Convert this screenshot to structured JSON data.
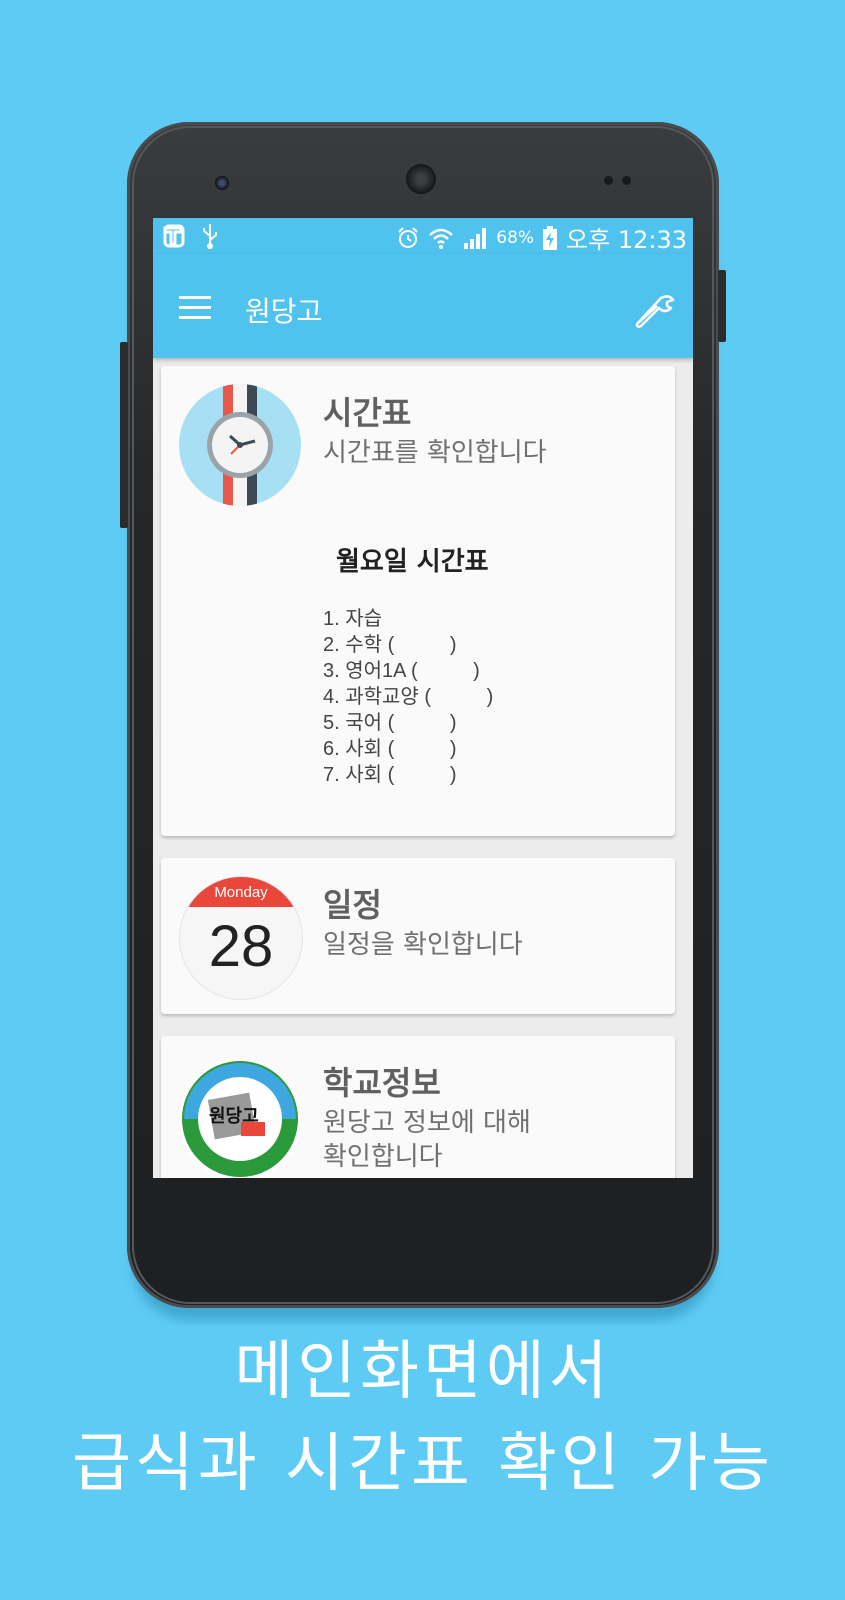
{
  "status_bar": {
    "battery_percent": "68%",
    "time": "오후 12:33",
    "icons": [
      "app-icon",
      "usb-icon",
      "alarm-icon",
      "wifi-icon",
      "signal-icon",
      "battery-icon"
    ]
  },
  "app_bar": {
    "title": "원당고",
    "menu_icon": "menu-icon",
    "settings_icon": "wrench-icon"
  },
  "cards": {
    "timetable": {
      "title": "시간표",
      "subtitle": "시간표를 확인합니다",
      "icon": "watch-icon",
      "heading": "월요일 시간표",
      "periods": [
        "1. 자습",
        "2. 수학 (          )",
        "3. 영어1A (          )",
        "4. 과학교양 (          )",
        "5. 국어 (          )",
        "6. 사회 (          )",
        "7. 사회 (          )"
      ]
    },
    "schedule": {
      "title": "일정",
      "subtitle": "일정을 확인합니다",
      "icon": "calendar-icon",
      "calendar_day": "Monday",
      "calendar_date": "28"
    },
    "school_info": {
      "title": "학교정보",
      "subtitle_line1": "원당고 정보에 대해",
      "subtitle_line2": "확인합니다",
      "icon": "school-emblem-icon",
      "emblem_text": "원당고"
    }
  },
  "caption": {
    "line1": "메인화면에서",
    "line2": "급식과 시간표 확인 가능"
  },
  "colors": {
    "background": "#5ecbf5",
    "app_bar": "#4fc3ee",
    "calendar_red": "#e8473a"
  }
}
